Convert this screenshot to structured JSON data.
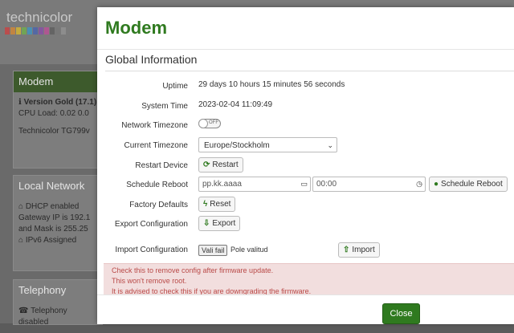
{
  "background": {
    "logo_text": "technicolor",
    "logo_colors": [
      "#e42f2f",
      "#f08a1d",
      "#f5c918",
      "#6bbf3c",
      "#2a9ed8",
      "#3b5bbf",
      "#8a3fb5",
      "#d13fa0",
      "#555555",
      "#777777",
      "#999999"
    ],
    "panels": [
      {
        "title": "Modem",
        "lines": [
          "Version Gold (17.1)",
          "CPU Load: 0.02 0.0",
          "",
          "Technicolor TG799v"
        ]
      },
      {
        "title": "Local Network",
        "lines": [
          "DHCP enabled",
          "Gateway IP is 192.1",
          "and Mask is 255.25",
          "IPv6 Assigned"
        ]
      },
      {
        "title": "Telephony",
        "lines": [
          "Telephony disabled"
        ]
      }
    ]
  },
  "modal": {
    "title": "Modem",
    "section_title": "Global Information",
    "uptime_label": "Uptime",
    "uptime_value": "29 days 10 hours 15 minutes 56 seconds",
    "system_time_label": "System Time",
    "system_time_value": "2023-02-04 11:09:49",
    "network_timezone_label": "Network Timezone",
    "network_timezone_state": "OFF",
    "current_timezone_label": "Current Timezone",
    "current_timezone_value": "Europe/Stockholm",
    "restart_device_label": "Restart Device",
    "restart_button": "Restart",
    "schedule_reboot_label": "Schedule Reboot",
    "date_placeholder": "pp.kk.aaaa",
    "time_placeholder": "00:00",
    "schedule_reboot_button": "Schedule Reboot",
    "factory_defaults_label": "Factory Defaults",
    "reset_button": "Reset",
    "export_configuration_label": "Export Configuration",
    "export_button": "Export",
    "import_configuration_label": "Import Configuration",
    "choose_file_button": "Vali fail",
    "no_file_text": "Pole valitud",
    "import_button": "Import",
    "alert_lines": [
      "Check this to remove config after firmware update.",
      "This won't remove root.",
      "It is advised to check this if you are downgrading the firmware."
    ],
    "close_button": "Close"
  }
}
